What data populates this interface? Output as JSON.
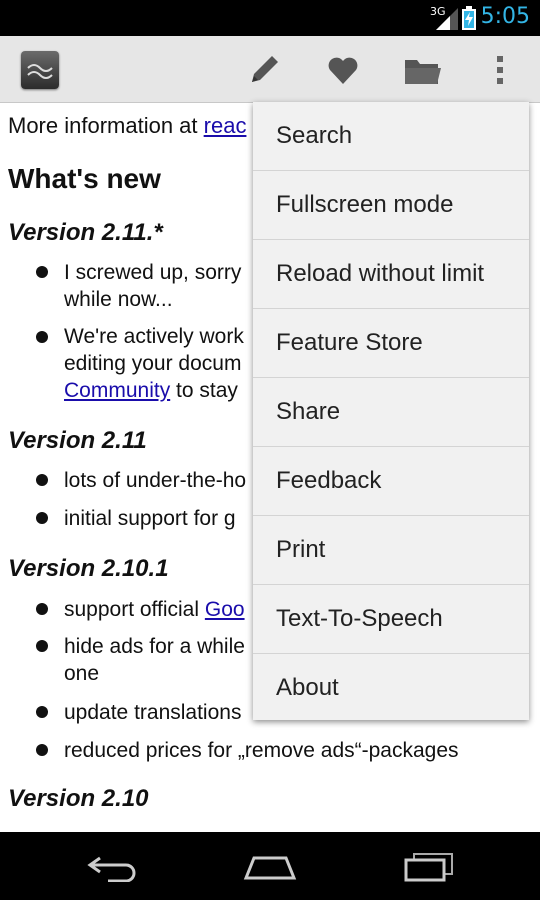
{
  "status_bar": {
    "network": "3G",
    "time": "5:05"
  },
  "action_bar": {
    "icons": [
      "app-logo",
      "pencil-icon",
      "heart-icon",
      "folder-icon",
      "overflow-menu-icon"
    ]
  },
  "content": {
    "info_prefix": "More information at ",
    "info_link": "reac",
    "whats_new": "What's new",
    "versions": [
      {
        "title": "Version 2.11.*",
        "items": [
          {
            "line1": "I screwed up, sorry",
            "line2": "while now..."
          },
          {
            "line1": "We're actively work",
            "line2": "editing your docum",
            "line3_link": "Community",
            "line3_rest": " to stay"
          }
        ]
      },
      {
        "title": "Version 2.11",
        "items": [
          {
            "line1": "lots of under-the-ho"
          },
          {
            "line1": "initial support for g"
          }
        ]
      },
      {
        "title": "Version 2.10.1",
        "items": [
          {
            "prefix": "support official ",
            "link": "Goo"
          },
          {
            "line1": "hide ads for a while",
            "line2": "one"
          },
          {
            "line1": "update translations"
          },
          {
            "line1": "reduced prices for „remove ads“-packages"
          }
        ]
      },
      {
        "title": "Version 2.10",
        "items": []
      }
    ]
  },
  "menu": {
    "items": [
      {
        "label": "Search"
      },
      {
        "label": "Fullscreen mode"
      },
      {
        "label": "Reload without limit"
      },
      {
        "label": "Feature Store"
      },
      {
        "label": "Share"
      },
      {
        "label": "Feedback"
      },
      {
        "label": "Print"
      },
      {
        "label": "Text-To-Speech"
      },
      {
        "label": "About"
      }
    ]
  },
  "colors": {
    "clock": "#33b5e5",
    "action_bar": "#e6e6e6",
    "link": "#1a0dab",
    "menu_bg": "#f1f1f1"
  }
}
